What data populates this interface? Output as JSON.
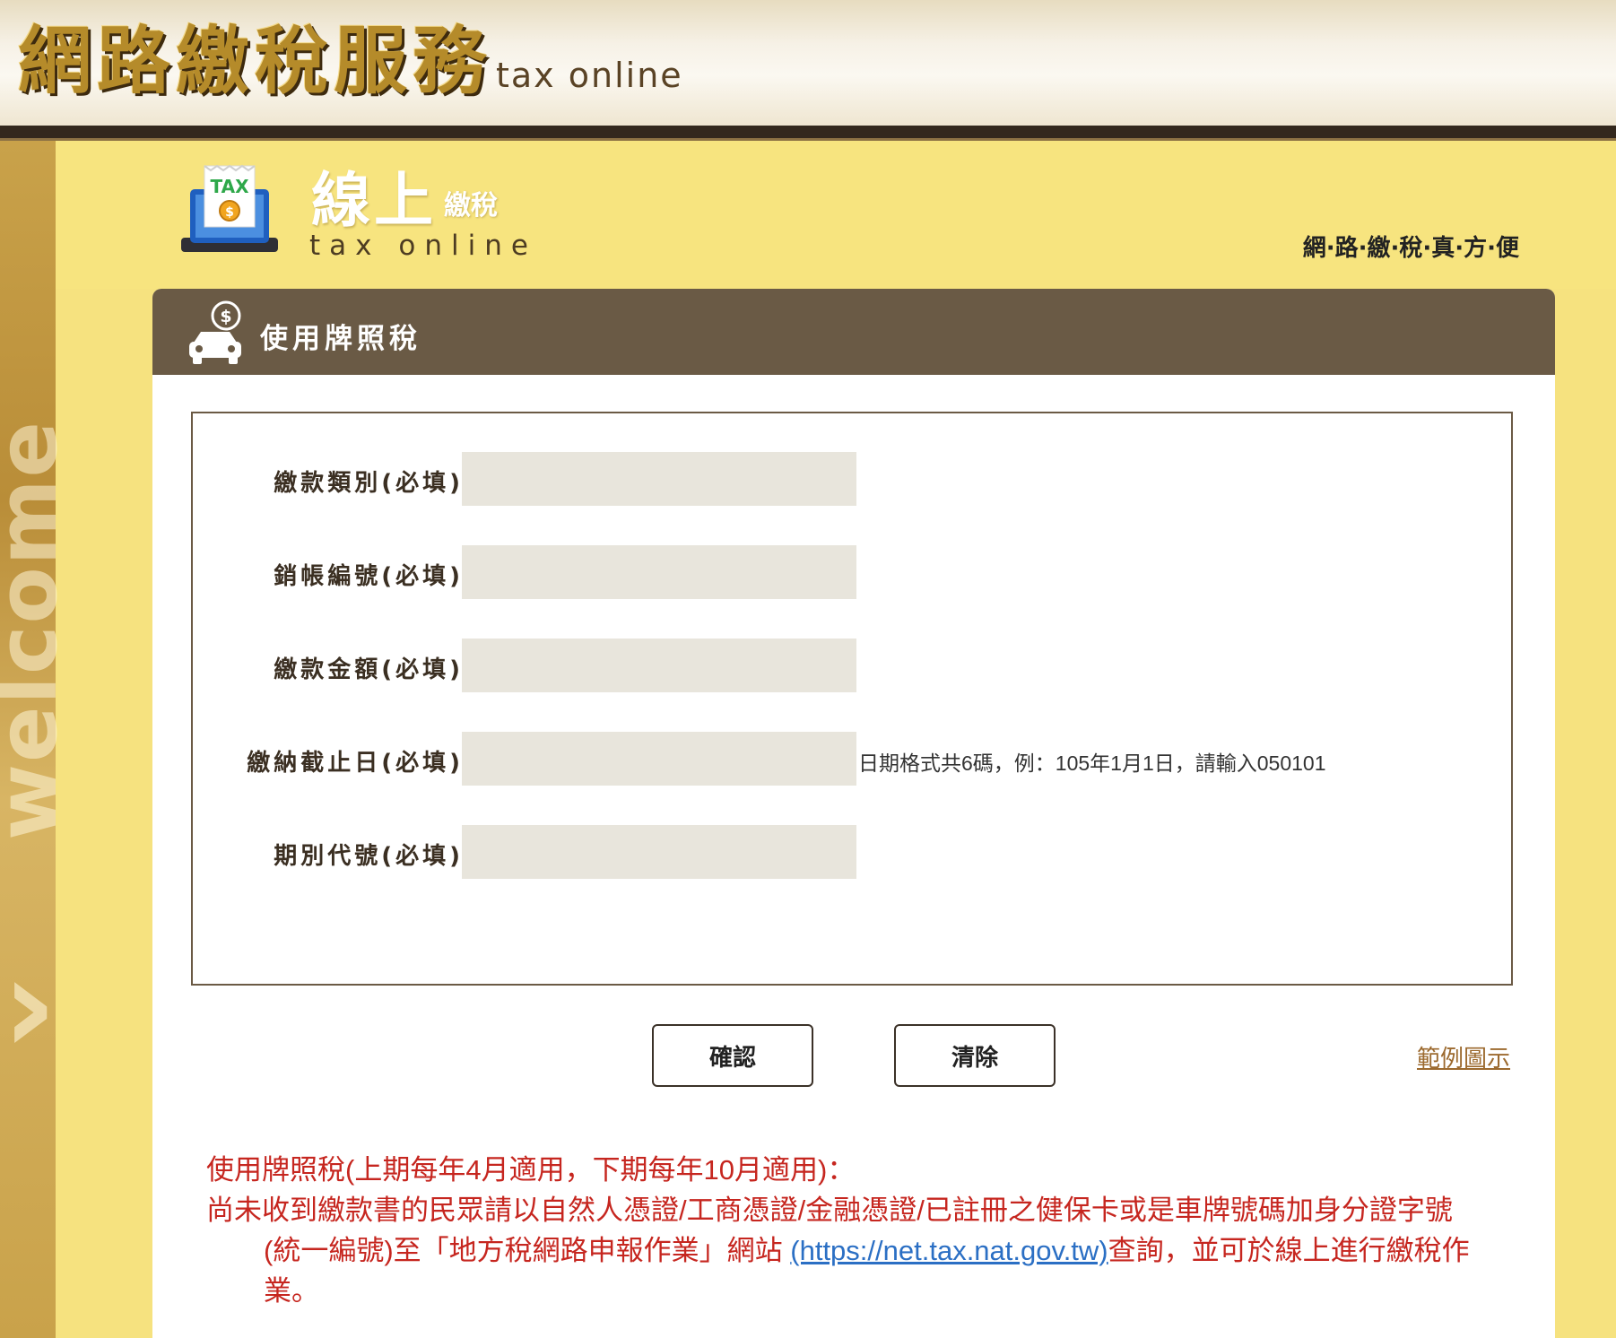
{
  "site": {
    "title": "網路繳稅服務",
    "subtitle": "tax online"
  },
  "side": {
    "watermark": "welcome"
  },
  "header": {
    "main": "線上",
    "small": "繳稅",
    "sub": "tax online",
    "slogan": "網·路·繳·稅·真·方·便",
    "icon_text": "TAX"
  },
  "panel": {
    "title": "使用牌照稅"
  },
  "form": {
    "fields": [
      {
        "label": "繳款類別(必填)",
        "value": "",
        "placeholder": ""
      },
      {
        "label": "銷帳編號(必填)",
        "value": "",
        "placeholder": ""
      },
      {
        "label": "繳款金額(必填)",
        "value": "",
        "placeholder": ""
      },
      {
        "label": "繳納截止日(必填)",
        "value": "",
        "placeholder": "",
        "hint": "日期格式共6碼，例：105年1月1日，請輸入050101"
      },
      {
        "label": "期別代號(必填)",
        "value": "",
        "placeholder": ""
      }
    ]
  },
  "buttons": {
    "confirm": "確認",
    "clear": "清除",
    "example": "範例圖示"
  },
  "notice": {
    "line1": "使用牌照稅(上期每年4月適用，下期每年10月適用)：",
    "line2_a": "尚未收到繳款書的民眾請以自然人憑證/工商憑證/金融憑證/已註冊之健保卡或是車牌號碼加身分證字號(統一編號)至「地方稅網路申報作業」網站 ",
    "link": "(https://net.tax.nat.gov.tw)",
    "line2_b": "查詢，並可於線上進行繳稅作業。"
  },
  "colors": {
    "panel_header": "#6a5a45",
    "page_bg": "#f6e27f",
    "notice_text": "#c6261f",
    "link": "#2b6fc4",
    "input_bg": "#e8e5dc"
  },
  "icons": [
    "tax-receipt-icon",
    "car-dollar-icon",
    "chevron-right-icon"
  ]
}
